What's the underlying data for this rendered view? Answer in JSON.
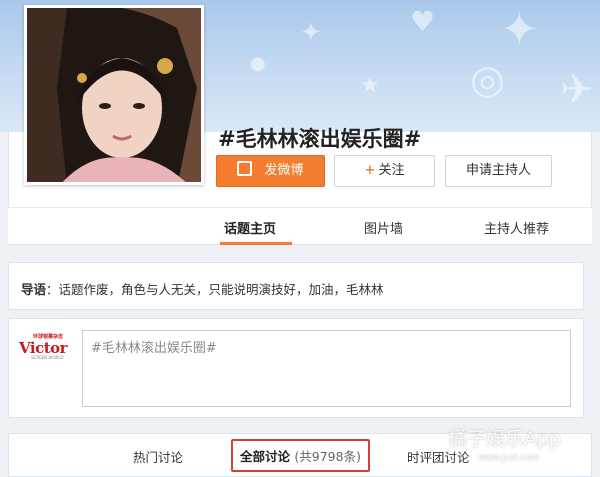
{
  "topic": {
    "title": "#毛林林滚出娱乐圈#"
  },
  "actions": {
    "post_label": "发微博",
    "follow_plus": "+",
    "follow_label": "关注",
    "host_label": "申请主持人"
  },
  "tabs": [
    {
      "label": "话题主页",
      "active": true
    },
    {
      "label": "图片墙",
      "active": false
    },
    {
      "label": "主持人推荐",
      "active": false
    }
  ],
  "intro": {
    "prefix": "导语",
    "text": "：话题作废，角色与人无关，只能说明演技好，加油，毛林林"
  },
  "composer": {
    "logo_small": "环球银幕杂志",
    "logo_word": "Victor",
    "logo_sub": "SCREEN WORLD",
    "placeholder": "#毛林林滚出娱乐圈#"
  },
  "feed_tabs": [
    {
      "label": "热门讨论"
    },
    {
      "label": "全部讨论",
      "count": "(共9798条)",
      "selected": true
    },
    {
      "label": "时评团讨论"
    }
  ],
  "watermark": {
    "text": "橘子娱乐App",
    "url": "www.juzi.com"
  },
  "colors": {
    "accent": "#f57d31",
    "highlight_box": "#d0433a",
    "banner": "#b7d2ee"
  },
  "icons": {
    "post": "edit-box-icon"
  }
}
